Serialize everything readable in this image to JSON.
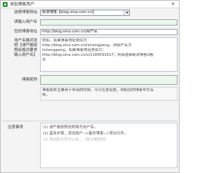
{
  "window": {
    "title": "添加博客用户",
    "close_glyph": "✕",
    "app_icon": "green-app-icon"
  },
  "site_row": {
    "label": "选择博客网站",
    "selected": "新浪博客【blog.sina.com.cn】"
  },
  "username_row": {
    "label": "请输入用户名",
    "value": ""
  },
  "blog_url_row": {
    "label": "您的博客地址",
    "value": "http://blog.sina.com.cn/用户名"
  },
  "format_row": {
    "label_lines": [
      "用户名格式说",
      "明【请严格按",
      "照此格式要求",
      "输入用户名】"
    ],
    "text_lines": [
      "例如，如果博客地址类似为：",
      "http://blog.sina.com.cn/lichengpeng，则用户名为",
      "lichengpeng，如果博客地址类似为：",
      "http://blog.sina.com.cn/u/1189591617，则请选择新浪博客2格",
      "式"
    ]
  },
  "nickname_row": {
    "label": "博客昵称",
    "value": ""
  },
  "hint": {
    "text_lines": [
      "博客昵称主要用于导出的时候，可以任意设置，例如您的博客中文名",
      "称。"
    ]
  },
  "notes": {
    "label": "注意事项",
    "lines": [
      "(1) 请严格按照说明填写用户名。",
      "(2) 基本步骤，添加用户-->备份博客-->导出文件。",
      "(3) 导出的文件可以在...（部分被遮挡）"
    ]
  },
  "colors": {
    "input_green": "#eaf7ea",
    "input_yellow": "#fffde0",
    "border": "#9aa3ad"
  }
}
